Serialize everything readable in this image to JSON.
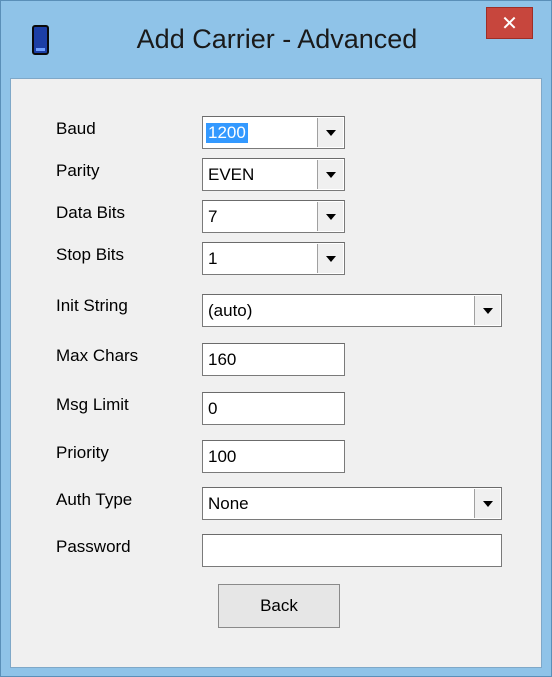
{
  "window": {
    "title": "Add Carrier - Advanced",
    "close_glyph": "✕"
  },
  "form": {
    "baud": {
      "label": "Baud",
      "value": "1200"
    },
    "parity": {
      "label": "Parity",
      "value": "EVEN"
    },
    "data_bits": {
      "label": "Data Bits",
      "value": "7"
    },
    "stop_bits": {
      "label": "Stop Bits",
      "value": "1"
    },
    "init_string": {
      "label": "Init String",
      "value": "(auto)"
    },
    "max_chars": {
      "label": "Max Chars",
      "value": "160"
    },
    "msg_limit": {
      "label": "Msg Limit",
      "value": "0"
    },
    "priority": {
      "label": "Priority",
      "value": "100"
    },
    "auth_type": {
      "label": "Auth Type",
      "value": "None"
    },
    "password": {
      "label": "Password",
      "value": ""
    }
  },
  "buttons": {
    "back": "Back"
  },
  "colors": {
    "frame": "#8fc3e8",
    "close": "#c7463d",
    "selection": "#3399ff",
    "client": "#f0f0f0"
  },
  "icons": {
    "app": "phone-icon",
    "close": "close-icon",
    "dropdown": "chevron-down-icon"
  }
}
